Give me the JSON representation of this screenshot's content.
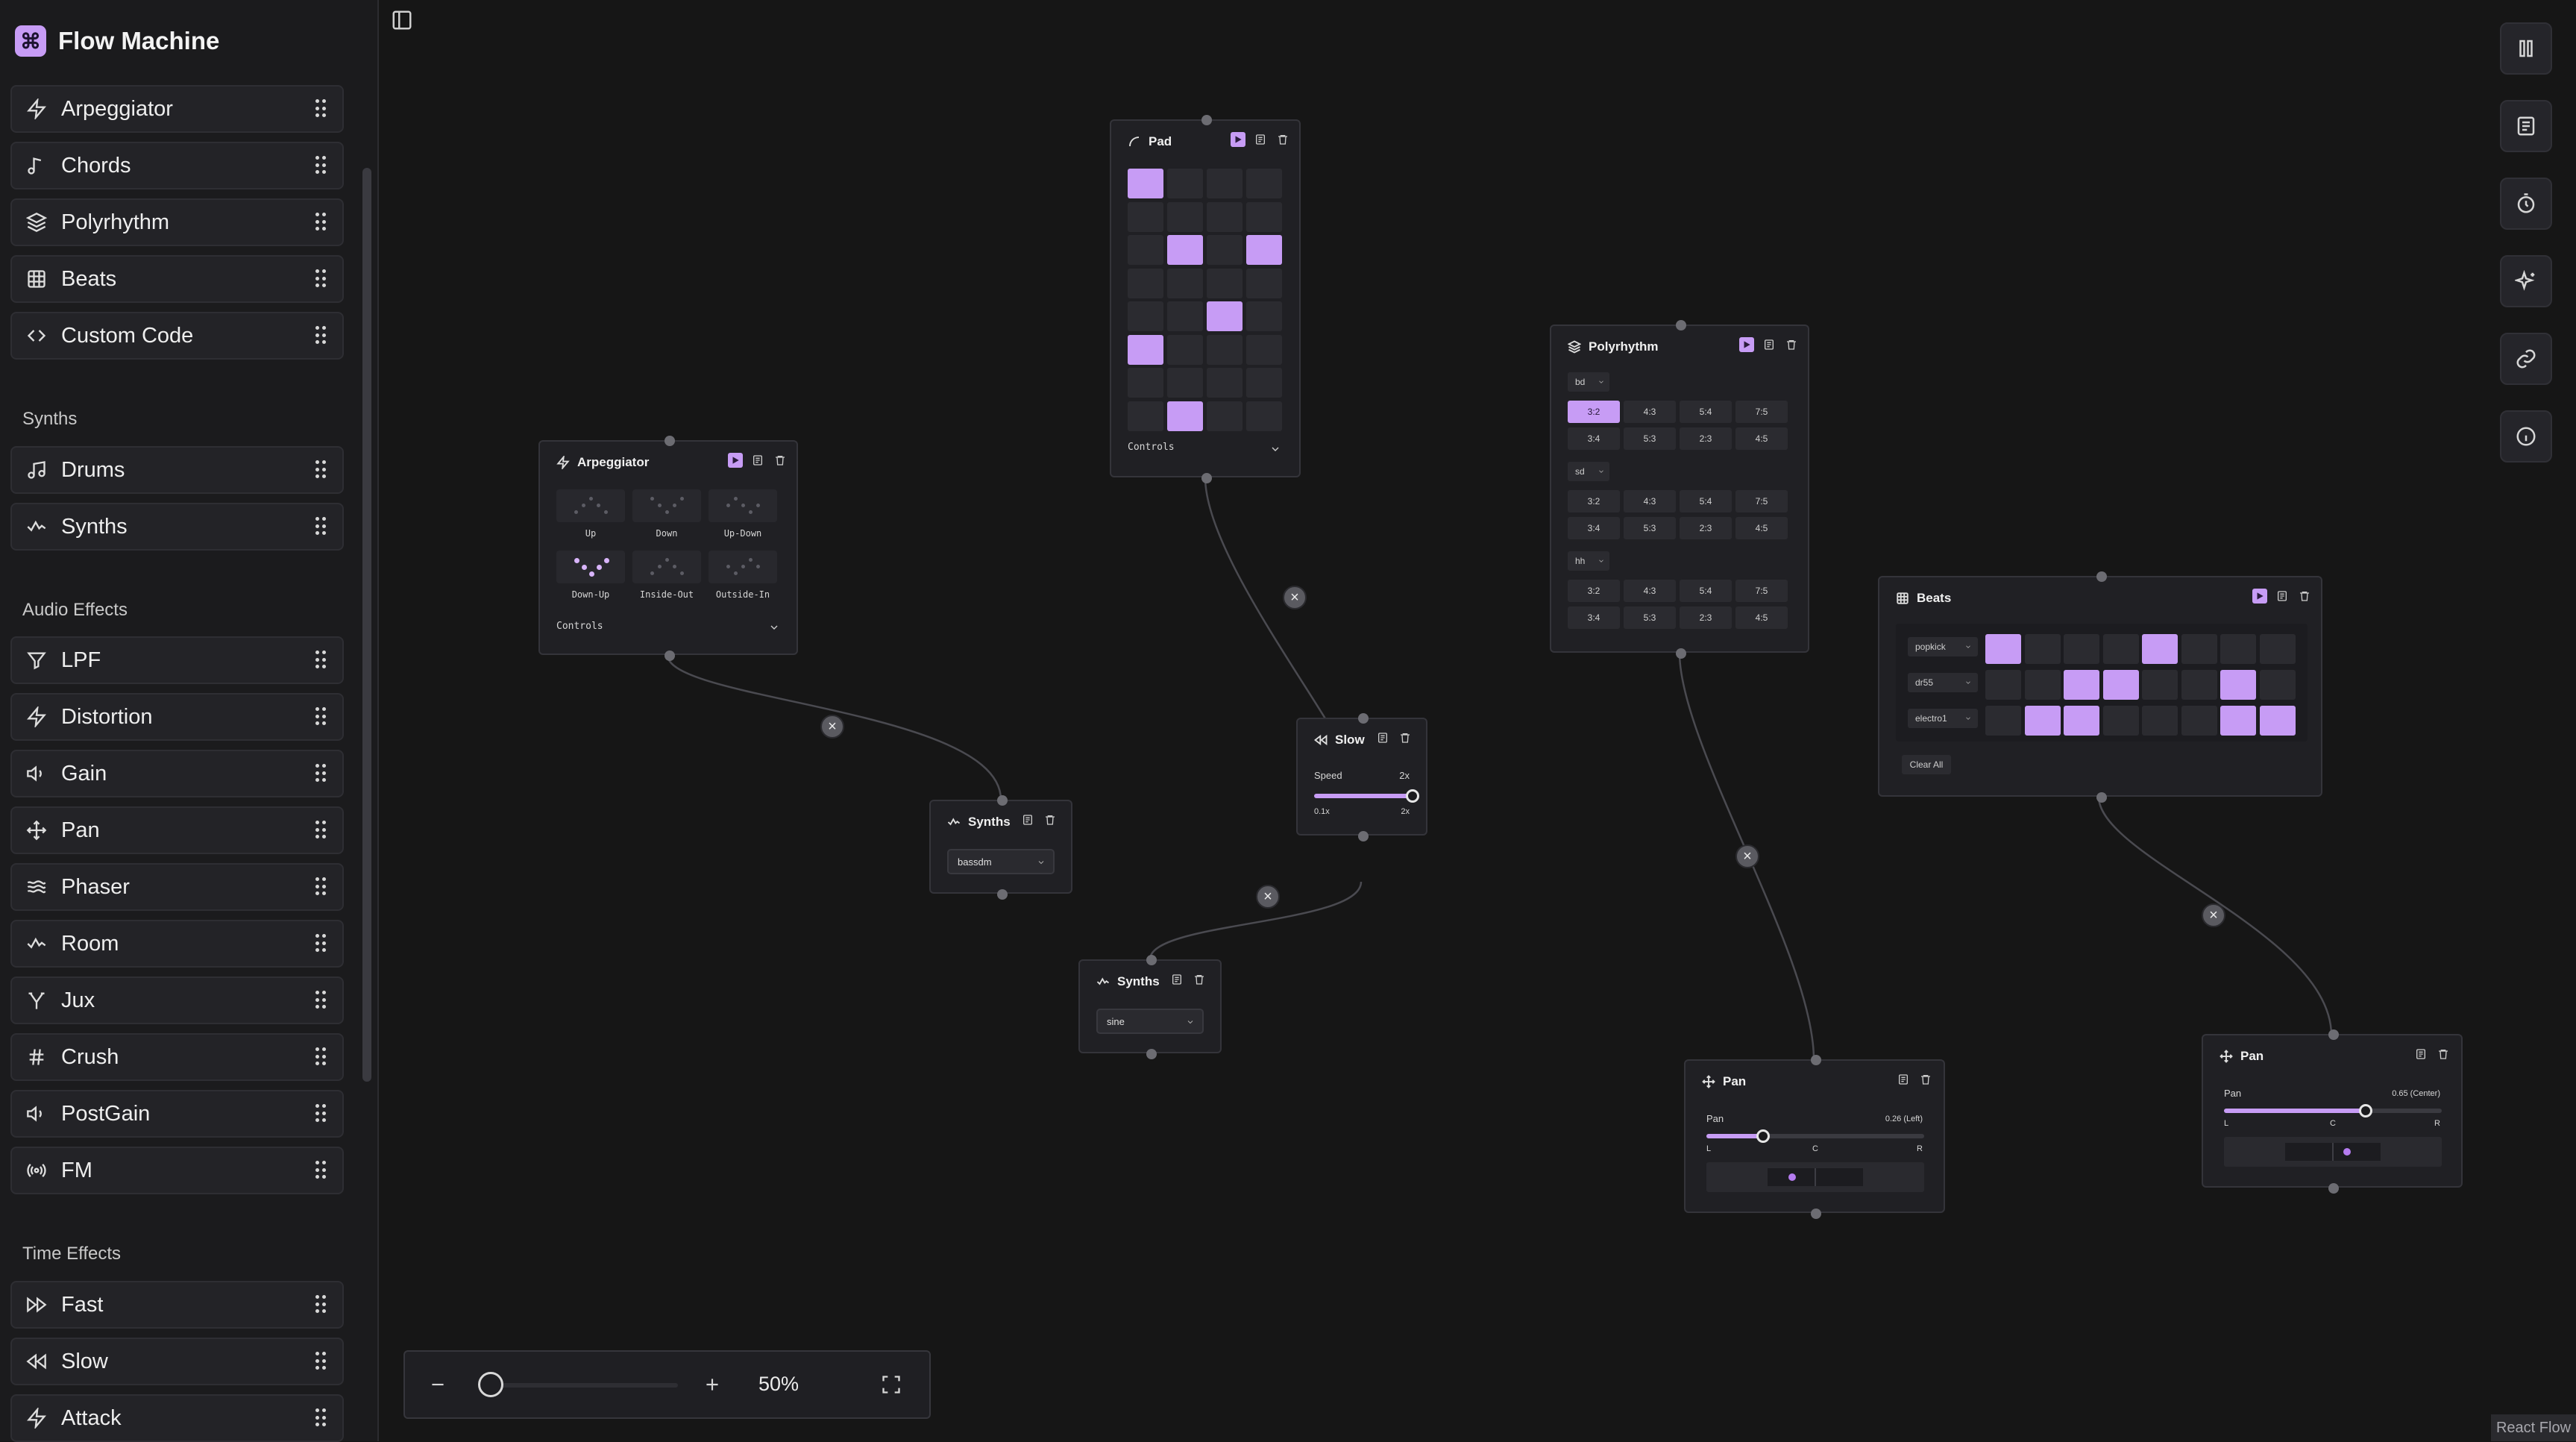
{
  "app": {
    "title": "Flow Machine"
  },
  "sidebar": {
    "patterns": [
      {
        "label": "Arpeggiator",
        "icon": "zap-icon"
      },
      {
        "label": "Chords",
        "icon": "music-note-icon"
      },
      {
        "label": "Polyrhythm",
        "icon": "layers-icon"
      },
      {
        "label": "Beats",
        "icon": "grid-icon"
      },
      {
        "label": "Custom Code",
        "icon": "code-icon"
      }
    ],
    "synths_header": "Synths",
    "synths": [
      {
        "label": "Drums",
        "icon": "music-notes-icon"
      },
      {
        "label": "Synths",
        "icon": "waveform-icon"
      }
    ],
    "audio_header": "Audio Effects",
    "audio": [
      {
        "label": "LPF",
        "icon": "filter-icon"
      },
      {
        "label": "Distortion",
        "icon": "zap-icon"
      },
      {
        "label": "Gain",
        "icon": "volume-icon"
      },
      {
        "label": "Pan",
        "icon": "move-icon"
      },
      {
        "label": "Phaser",
        "icon": "waves-icon"
      },
      {
        "label": "Room",
        "icon": "waveform-icon"
      },
      {
        "label": "Jux",
        "icon": "split-icon"
      },
      {
        "label": "Crush",
        "icon": "hash-icon"
      },
      {
        "label": "PostGain",
        "icon": "volume-icon"
      },
      {
        "label": "FM",
        "icon": "radio-icon"
      }
    ],
    "time_header": "Time Effects",
    "time": [
      {
        "label": "Fast",
        "icon": "fast-forward-icon"
      },
      {
        "label": "Slow",
        "icon": "rewind-icon"
      },
      {
        "label": "Attack",
        "icon": "zap-icon"
      }
    ]
  },
  "nodes": {
    "pad": {
      "title": "Pad",
      "controls": "Controls",
      "grid": [
        [
          1,
          0,
          0,
          0
        ],
        [
          0,
          0,
          0,
          0
        ],
        [
          0,
          1,
          0,
          1
        ],
        [
          0,
          0,
          0,
          0
        ],
        [
          0,
          0,
          1,
          0
        ],
        [
          1,
          0,
          0,
          0
        ],
        [
          0,
          0,
          0,
          0
        ],
        [
          0,
          1,
          0,
          0
        ]
      ]
    },
    "arpeggiator": {
      "title": "Arpeggiator",
      "controls": "Controls",
      "modes": [
        "Up",
        "Down",
        "Up-Down",
        "Down-Up",
        "Inside-Out",
        "Outside-In"
      ],
      "selected": "Down-Up"
    },
    "polyrhythm": {
      "title": "Polyrhythm",
      "tracks": [
        {
          "sample": "bd",
          "selected": "3:2"
        },
        {
          "sample": "sd",
          "selected": ""
        },
        {
          "sample": "hh",
          "selected": ""
        }
      ],
      "ratios": [
        "3:2",
        "4:3",
        "5:4",
        "7:5",
        "3:4",
        "5:3",
        "2:3",
        "4:5"
      ]
    },
    "beats": {
      "title": "Beats",
      "clear": "Clear All",
      "rows": [
        {
          "sample": "popkick",
          "steps": [
            1,
            0,
            0,
            0,
            1,
            0,
            0,
            0
          ]
        },
        {
          "sample": "dr55",
          "steps": [
            0,
            0,
            1,
            1,
            0,
            0,
            1,
            0
          ]
        },
        {
          "sample": "electro1",
          "steps": [
            0,
            1,
            1,
            0,
            0,
            0,
            1,
            1
          ]
        }
      ]
    },
    "synths_a": {
      "title": "Synths",
      "value": "bassdm"
    },
    "synths_b": {
      "title": "Synths",
      "value": "sine"
    },
    "slow": {
      "title": "Slow",
      "label": "Speed",
      "value": "2x",
      "min": "0.1x",
      "max": "2x",
      "fraction": 1.0
    },
    "pan_a": {
      "title": "Pan",
      "label": "Pan",
      "value": "0.26 (Left)",
      "l": "L",
      "c": "C",
      "r": "R",
      "fraction": 0.26
    },
    "pan_b": {
      "title": "Pan",
      "label": "Pan",
      "value": "0.65 (Center)",
      "l": "L",
      "c": "C",
      "r": "R",
      "fraction": 0.65
    }
  },
  "right_toolbar": [
    "pause-icon",
    "notes-icon",
    "timer-icon",
    "sparkles-icon",
    "link-icon",
    "info-icon"
  ],
  "zoom": {
    "level": "50%",
    "fraction": 0.0
  },
  "attribution": "React Flow",
  "colors": {
    "accent": "#c79cf5",
    "background": "#161616",
    "node": "#202024"
  }
}
